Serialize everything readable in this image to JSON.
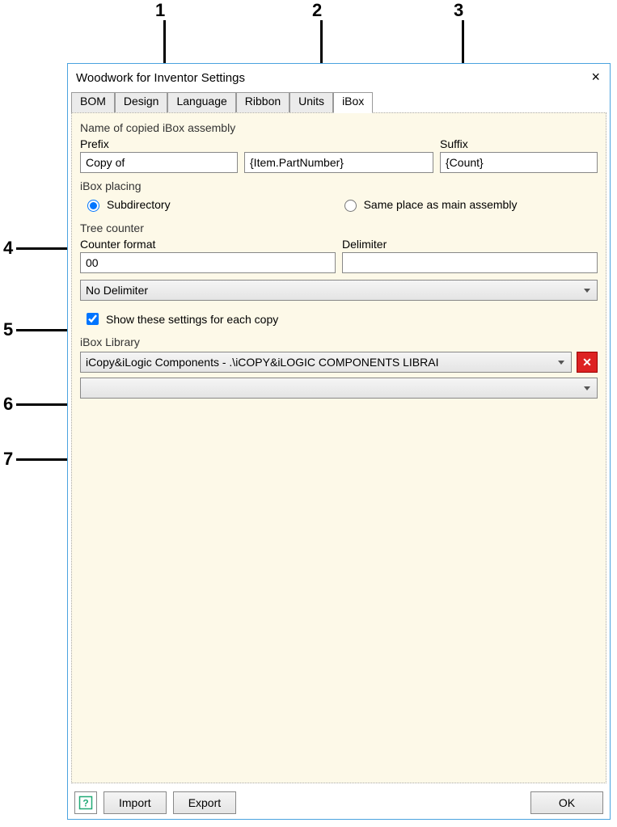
{
  "callouts": {
    "1": "1",
    "2": "2",
    "3": "3",
    "4": "4",
    "5": "5",
    "6": "6",
    "7": "7"
  },
  "window": {
    "title": "Woodwork for Inventor Settings",
    "close": "×"
  },
  "tabs": [
    "BOM",
    "Design",
    "Language",
    "Ribbon",
    "Units",
    "iBox"
  ],
  "activeTab": "iBox",
  "groups": {
    "nameCopied": {
      "legend": "Name of copied iBox assembly",
      "prefixLabel": "Prefix",
      "prefixValue": "Copy of",
      "midValue": "{Item.PartNumber}",
      "suffixLabel": "Suffix",
      "suffixValue": "{Count}"
    },
    "placing": {
      "legend": "iBox placing",
      "opt1": "Subdirectory",
      "opt2": "Same place as main assembly",
      "selected": "opt1"
    },
    "treeCounter": {
      "legend": "Tree counter",
      "counterFormatLabel": "Counter format",
      "counterFormatValue": "00",
      "delimiterLabel": "Delimiter",
      "delimiterValue": "",
      "noDelimiter": "No Delimiter"
    },
    "showSettings": {
      "label": "Show these settings for each copy",
      "checked": true
    },
    "library": {
      "legend": "iBox Library",
      "select1": "iCopy&iLogic Components  -  .\\iCOPY&iLOGIC COMPONENTS LIBRAI",
      "select2": ""
    }
  },
  "footer": {
    "import": "Import",
    "export": "Export",
    "ok": "OK"
  }
}
